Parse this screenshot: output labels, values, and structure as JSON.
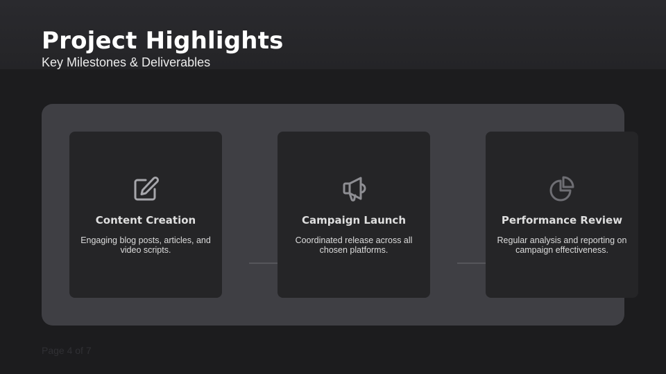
{
  "header": {
    "title": "Project Highlights",
    "subtitle": "Key Milestones & Deliverables"
  },
  "milestones": [
    {
      "icon": "pencil-square-icon",
      "title": "Content Creation",
      "description": "Engaging blog posts, articles, and video scripts."
    },
    {
      "icon": "megaphone-icon",
      "title": "Campaign Launch",
      "description": "Coordinated release across all chosen platforms."
    },
    {
      "icon": "pie-chart-icon",
      "title": "Performance Review",
      "description": "Regular analysis and reporting on campaign effectiveness."
    }
  ],
  "footer": {
    "page_indicator": "Page 4 of 7"
  },
  "colors": {
    "background": "#1c1c1e",
    "panel": "#3f3f44",
    "card": "#252527",
    "icon_gray": "#8e8e93",
    "text": "#dedede"
  }
}
